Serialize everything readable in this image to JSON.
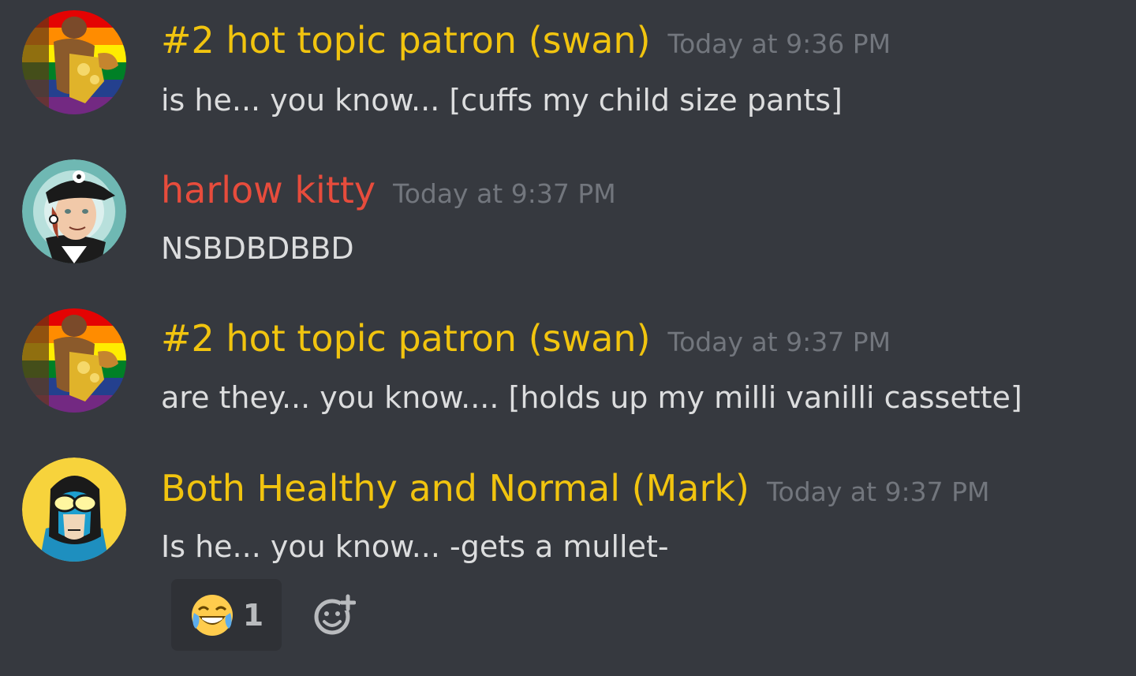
{
  "colors": {
    "background": "#36393f",
    "username_yellow": "#f1c40f",
    "username_red": "#e74c3c",
    "timestamp": "#72767d",
    "message_text": "#dcddde",
    "reaction_bg": "#2f3136"
  },
  "messages": [
    {
      "author": "#2 hot topic patron (swan)",
      "author_color": "#f1c40f",
      "timestamp": "Today at 9:36 PM",
      "text": "is he... you know... [cuffs my child size pants]",
      "avatar": "rainbow-flag-avatar"
    },
    {
      "author": "harlow kitty",
      "author_color": "#e74c3c",
      "timestamp": "Today at 9:37 PM",
      "text": "NSBDBDBBD",
      "avatar": "cap-avatar"
    },
    {
      "author": "#2 hot topic patron (swan)",
      "author_color": "#f1c40f",
      "timestamp": "Today at 9:37 PM",
      "text": "are they... you know.... [holds up my milli vanilli cassette]",
      "avatar": "rainbow-flag-avatar"
    },
    {
      "author": "Both Healthy and Normal (Mark)",
      "author_color": "#f1c40f",
      "timestamp": "Today at 9:37 PM",
      "text": "Is he... you know... -gets a mullet-",
      "avatar": "goggles-avatar"
    }
  ],
  "reactions": [
    {
      "emoji": "joy-emoji-icon",
      "count": "1"
    }
  ],
  "add_reaction_icon": "add-reaction-icon"
}
